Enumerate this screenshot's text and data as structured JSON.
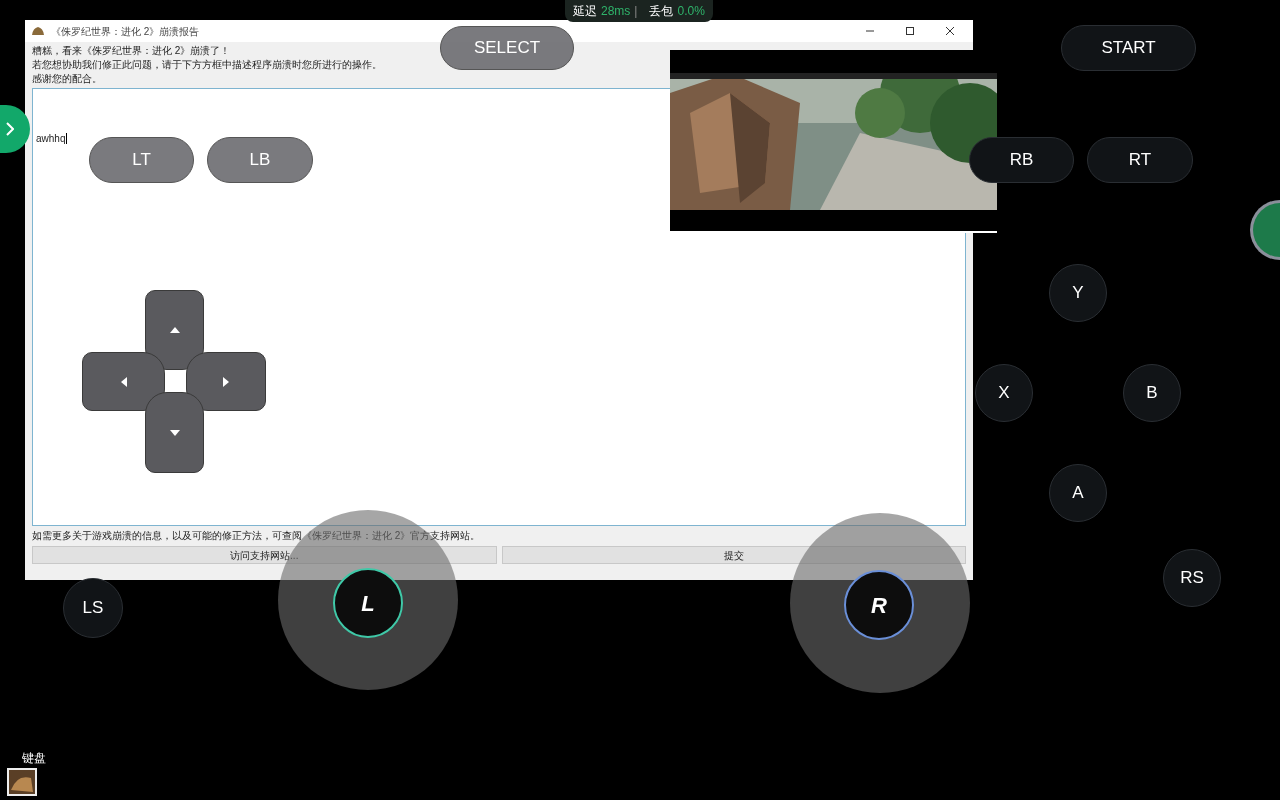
{
  "stats": {
    "latency_label": "延迟",
    "latency": "28ms",
    "separator": "|",
    "loss_label": "丢包",
    "loss": "0.0%"
  },
  "dialog": {
    "title": "《侏罗纪世界：进化 2》崩溃报告",
    "message_lines": [
      "糟糕，看来《侏罗纪世界：进化 2》崩溃了！",
      "若您想协助我们修正此问题，请于下方方框中描述程序崩溃时您所进行的操作。",
      "感谢您的配合。"
    ],
    "report_text": "awhhq",
    "footer_note": "如需更多关于游戏崩溃的信息，以及可能的修正方法，可查阅《侏罗纪世界：进化 2》官方支持网站。",
    "buttons": [
      "访问支持网站...",
      "提交"
    ]
  },
  "controls": [
    {
      "kind": "pill",
      "label": "SELECT"
    },
    {
      "kind": "pill",
      "label": "START"
    },
    {
      "kind": "pill",
      "label": "LT"
    },
    {
      "kind": "pill",
      "label": "LB"
    },
    {
      "kind": "pill",
      "label": "RB"
    },
    {
      "kind": "pill",
      "label": "RT"
    },
    {
      "kind": "round",
      "label": "Y"
    },
    {
      "kind": "round",
      "label": "X"
    },
    {
      "kind": "round",
      "label": "B"
    },
    {
      "kind": "round",
      "label": "A"
    },
    {
      "kind": "round",
      "label": "RS"
    },
    {
      "kind": "round",
      "label": "LS"
    },
    {
      "kind": "stick",
      "label": "L",
      "color": "#3fc9a8"
    },
    {
      "kind": "stick",
      "label": "R",
      "color": "#6a8fd8"
    }
  ],
  "keyboard_label": "键盘"
}
